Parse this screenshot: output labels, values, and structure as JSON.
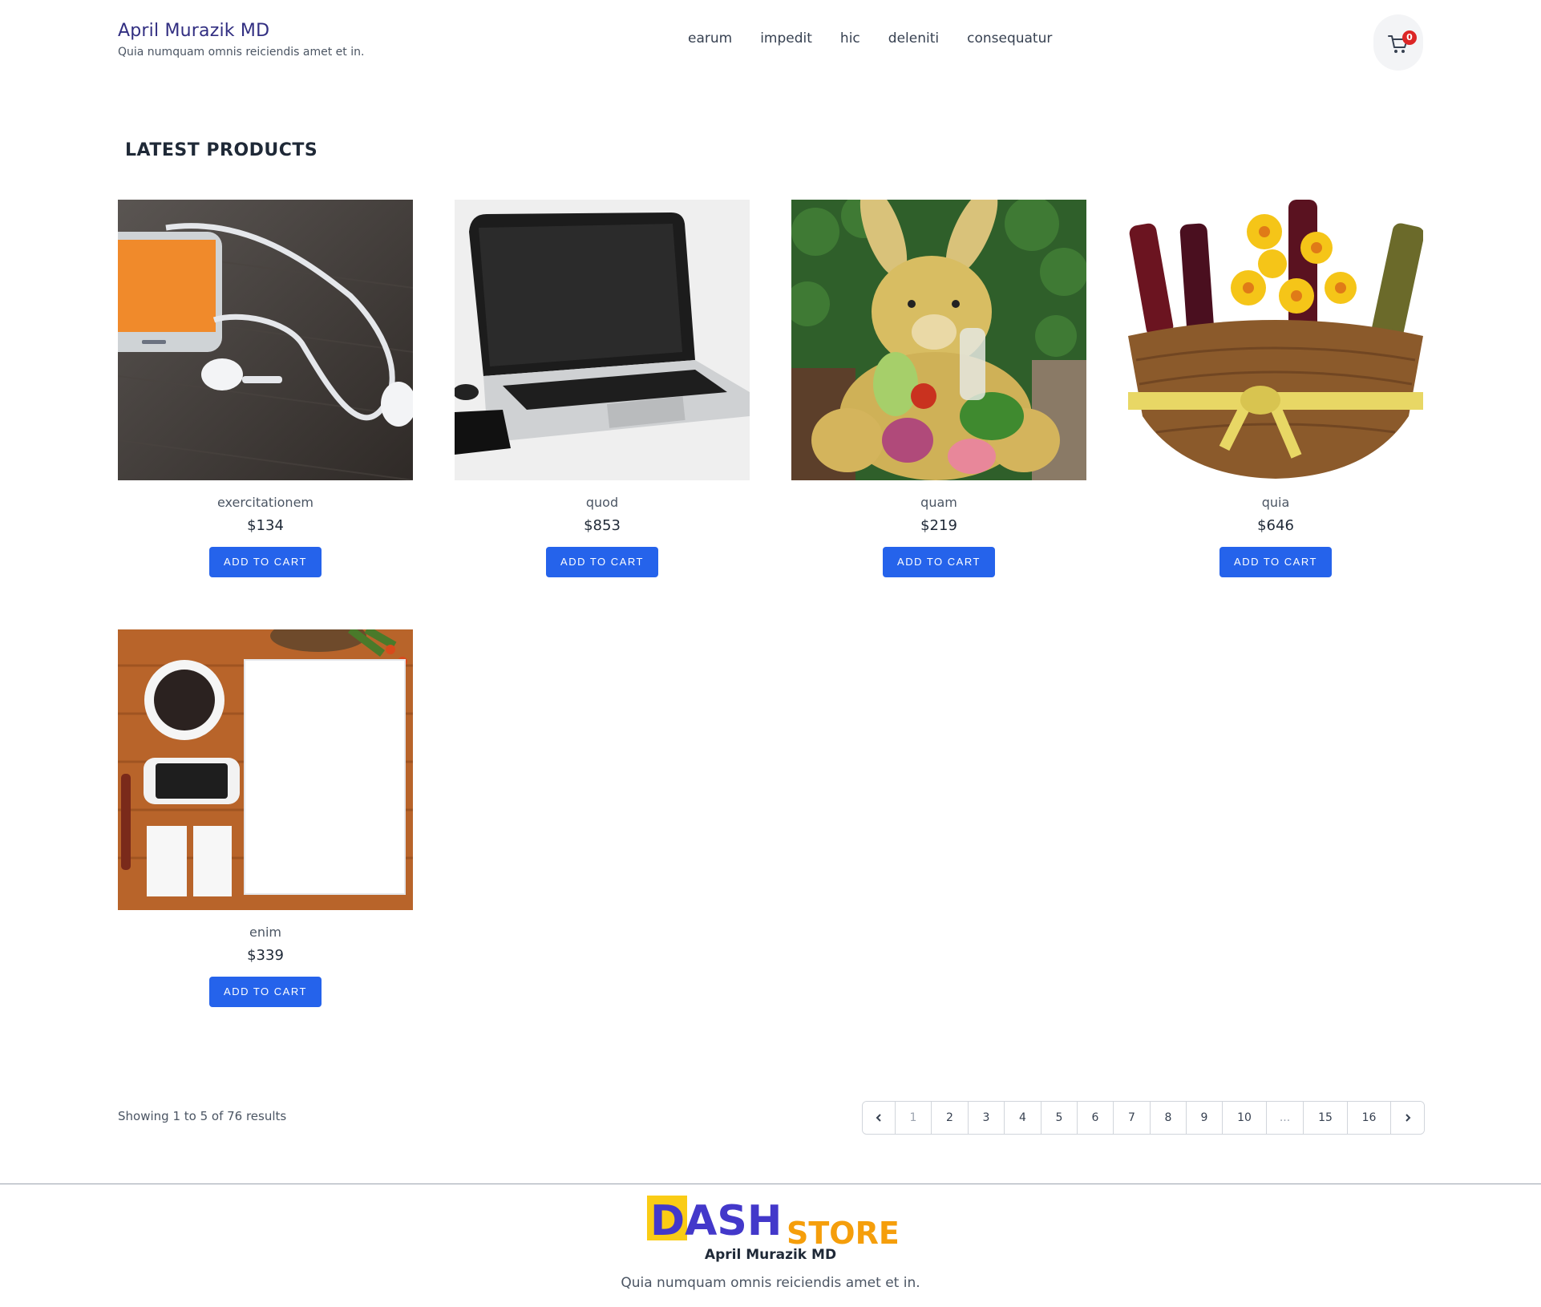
{
  "header": {
    "title": "April Murazik MD",
    "tagline": "Quia numquam omnis reiciendis amet et in.",
    "nav": [
      "earum",
      "impedit",
      "hic",
      "deleniti",
      "consequatur"
    ],
    "cart_count": "0"
  },
  "section_title": "LATEST PRODUCTS",
  "products": [
    {
      "name": "exercitationem",
      "price": "$134",
      "button": "ADD TO CART",
      "image": "phone-earphones-photo"
    },
    {
      "name": "quod",
      "price": "$853",
      "button": "ADD TO CART",
      "image": "laptop-photo"
    },
    {
      "name": "quam",
      "price": "$219",
      "button": "ADD TO CART",
      "image": "plush-bunny-photo"
    },
    {
      "name": "quia",
      "price": "$646",
      "button": "ADD TO CART",
      "image": "wine-basket-photo"
    },
    {
      "name": "enim",
      "price": "$339",
      "button": "ADD TO CART",
      "image": "desk-coffee-mockup-photo"
    }
  ],
  "pagination": {
    "summary": "Showing 1 to 5 of 76 results",
    "prev_icon": "chevron-left-icon",
    "next_icon": "chevron-right-icon",
    "pages": [
      "1",
      "2",
      "3",
      "4",
      "5",
      "6",
      "7",
      "8",
      "9",
      "10",
      "...",
      "15",
      "16"
    ]
  },
  "footer": {
    "logo_text_1": "DASH",
    "logo_text_2": "STORE",
    "name": "April Murazik MD",
    "tagline": "Quia numquam omnis reiciendis amet et in."
  },
  "colors": {
    "accent": "#2563eb",
    "brand": "#312e81",
    "badge": "#dc2626"
  }
}
